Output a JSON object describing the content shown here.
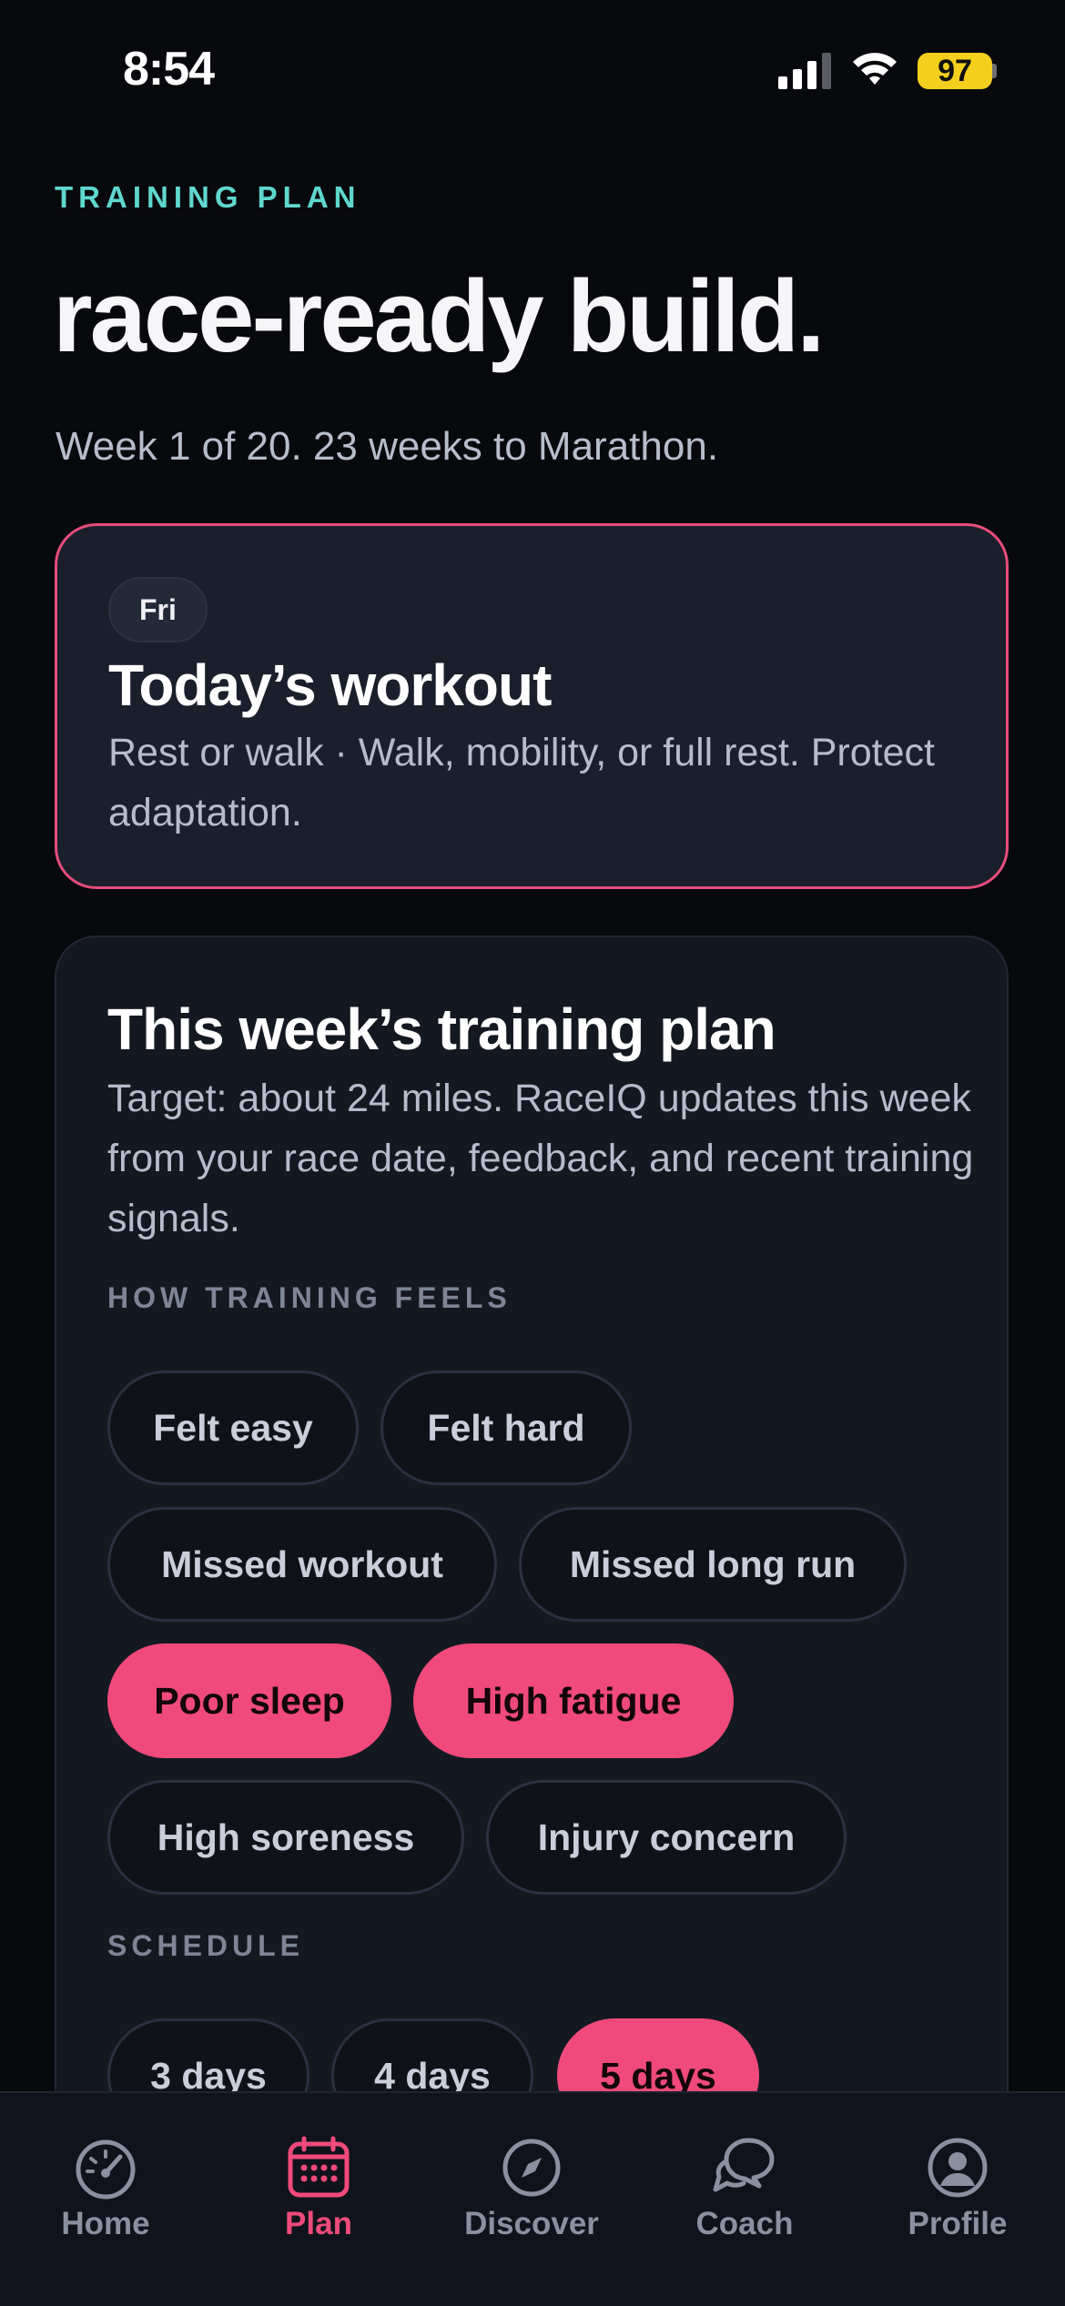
{
  "status_bar": {
    "time": "8:54",
    "battery": "97"
  },
  "header": {
    "eyebrow": "TRAINING PLAN",
    "title": "race-ready build.",
    "subtitle": "Week 1 of 20. 23 weeks to Marathon."
  },
  "today": {
    "day": "Fri",
    "title": "Today’s workout",
    "description": "Rest or walk · Walk, mobility, or full rest. Protect adaptation."
  },
  "week": {
    "title": "This week’s training plan",
    "description": "Target: about 24 miles. RaceIQ updates this week from your race date, feedback, and recent training signals.",
    "feels_label": "HOW TRAINING FEELS",
    "feels_chips": [
      {
        "label": "Felt easy",
        "selected": false
      },
      {
        "label": "Felt hard",
        "selected": false
      },
      {
        "label": "Missed workout",
        "selected": false
      },
      {
        "label": "Missed long run",
        "selected": false
      },
      {
        "label": "Poor sleep",
        "selected": true
      },
      {
        "label": "High fatigue",
        "selected": true
      },
      {
        "label": "High soreness",
        "selected": false
      },
      {
        "label": "Injury concern",
        "selected": false
      }
    ],
    "schedule_label": "SCHEDULE",
    "schedule_chips": [
      {
        "label": "3 days",
        "selected": false
      },
      {
        "label": "4 days",
        "selected": false
      },
      {
        "label": "5 days",
        "selected": true
      }
    ]
  },
  "tabbar": {
    "tabs": [
      {
        "label": "Home",
        "icon": "gauge-icon"
      },
      {
        "label": "Plan",
        "icon": "calendar-icon",
        "active": true
      },
      {
        "label": "Discover",
        "icon": "compass-icon"
      },
      {
        "label": "Coach",
        "icon": "chat-bubbles-icon"
      },
      {
        "label": "Profile",
        "icon": "person-circle-icon"
      }
    ]
  },
  "colors": {
    "accent": "#ef4a7b",
    "eyebrow": "#5fd7cf",
    "battery": "#f5cf1e"
  }
}
